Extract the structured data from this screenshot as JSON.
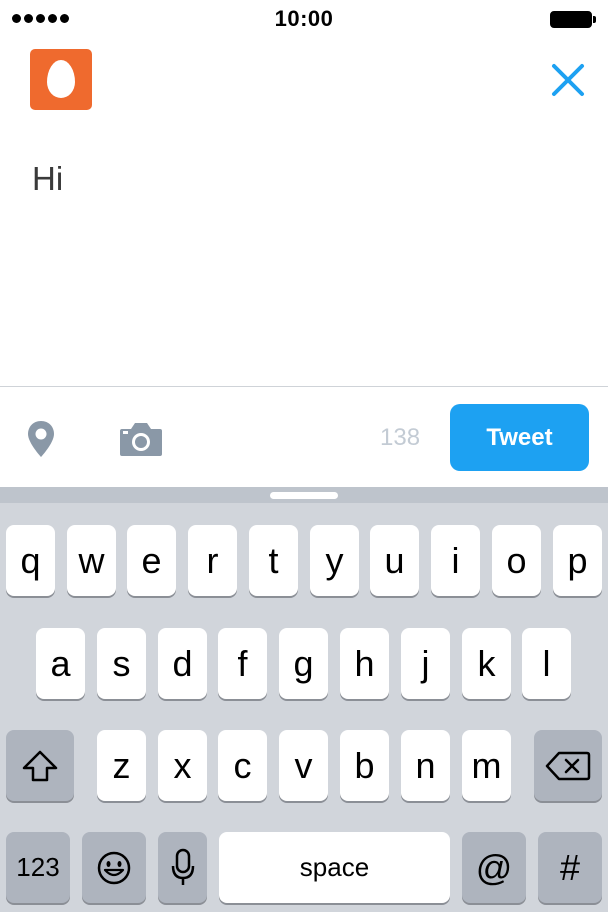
{
  "status_bar": {
    "time": "10:00"
  },
  "composer": {
    "text": "Hi",
    "char_count": "138",
    "tweet_label": "Tweet"
  },
  "keyboard": {
    "row1": [
      "q",
      "w",
      "e",
      "r",
      "t",
      "y",
      "u",
      "i",
      "o",
      "p"
    ],
    "row2": [
      "a",
      "s",
      "d",
      "f",
      "g",
      "h",
      "j",
      "k",
      "l"
    ],
    "row3": [
      "z",
      "x",
      "c",
      "v",
      "b",
      "n",
      "m"
    ],
    "numbers_label": "123",
    "space_label": "space",
    "at_label": "@",
    "hash_label": "#"
  },
  "colors": {
    "accent": "#1da1f2",
    "avatar": "#ef6a2e",
    "keyboard_bg": "#d1d5db",
    "icon_gray": "#8a98a7"
  }
}
